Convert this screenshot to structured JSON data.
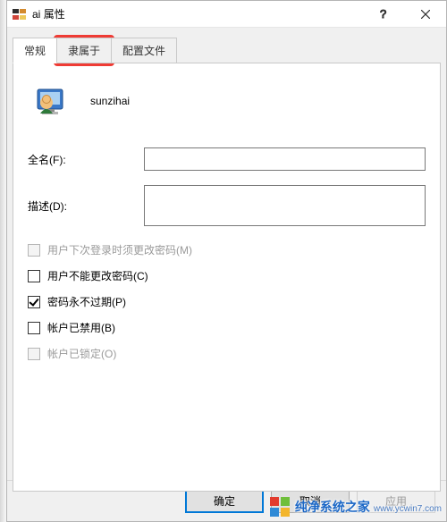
{
  "window": {
    "title_prefix": "ai",
    "title_suffix": "属性",
    "close_label": "Close",
    "help_label": "Help"
  },
  "tabs": {
    "items": [
      {
        "label": "常规",
        "active": true
      },
      {
        "label": "隶属于",
        "active": false,
        "highlighted": true
      },
      {
        "label": "配置文件",
        "active": false
      }
    ]
  },
  "user": {
    "name": "sunzihai"
  },
  "fields": {
    "fullname": {
      "label": "全名(F):",
      "value": ""
    },
    "description": {
      "label": "描述(D):",
      "value": ""
    }
  },
  "checkboxes": {
    "must_change": {
      "label": "用户下次登录时须更改密码(M)",
      "checked": false,
      "disabled": true
    },
    "cannot_change": {
      "label": "用户不能更改密码(C)",
      "checked": false,
      "disabled": false
    },
    "never_expire": {
      "label": "密码永不过期(P)",
      "checked": true,
      "disabled": false
    },
    "disabled_acct": {
      "label": "帐户已禁用(B)",
      "checked": false,
      "disabled": false
    },
    "locked": {
      "label": "帐户已锁定(O)",
      "checked": false,
      "disabled": true
    }
  },
  "buttons": {
    "ok": "确定",
    "cancel": "取消",
    "apply": "应用"
  },
  "watermark": {
    "text": "纯净系统之家",
    "url": "www.ycwin7.com"
  }
}
